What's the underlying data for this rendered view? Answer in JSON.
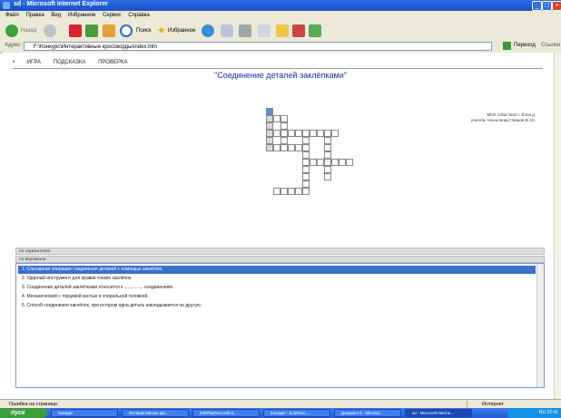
{
  "window": {
    "title": "sd - Microsoft Internet Explorer"
  },
  "menu": [
    "Файл",
    "Правка",
    "Вид",
    "Избранное",
    "Сервис",
    "Справка"
  ],
  "toolbar": {
    "back": "Назад",
    "search": "Поиск",
    "favorites": "Избранное"
  },
  "address": {
    "label": "Адрес:",
    "url": "F:\\Конкурс\\Интерактивные кроссворды\\index.htm",
    "go": "Переход",
    "links": "Ссылки"
  },
  "nav": [
    "ИГРА",
    "ПОДСКАЗКА",
    "ПРОВЕРКА"
  ],
  "page_title": "\"Соединение деталей заклёпками\"",
  "school": [
    "МОУ СОШ №42 г. Ёлхи д.",
    "учитель технологии Глазков В. Ю."
  ],
  "panels": {
    "across": "по горизонтали",
    "down": "по вертикали"
  },
  "questions": [
    "1. Слесарная операция соединения деталей с помощью заклёпок.",
    "2. Ударный инструмент для правки тонких заклёпок.",
    "3. Соединение деталей заклёпками относится к ............... соединениям.",
    "4. Механический с торцевой кистью и спиральной головкой.",
    "5. Способ соединения заклёпок, при котором одна деталь накладывается на другую."
  ],
  "status": {
    "left": "Ошибка на странице.",
    "right": "Интернет"
  },
  "taskbar": {
    "start": "пуск",
    "tasks": [
      "Конкурс",
      "Интерактивные кро...",
      "ZoltPlayRecord2.0...",
      "Конкурс - 9.doPacr...",
      "Документ1 - Microso...",
      "sd - Microsoft Interne..."
    ],
    "clock": "RU 22:41"
  }
}
